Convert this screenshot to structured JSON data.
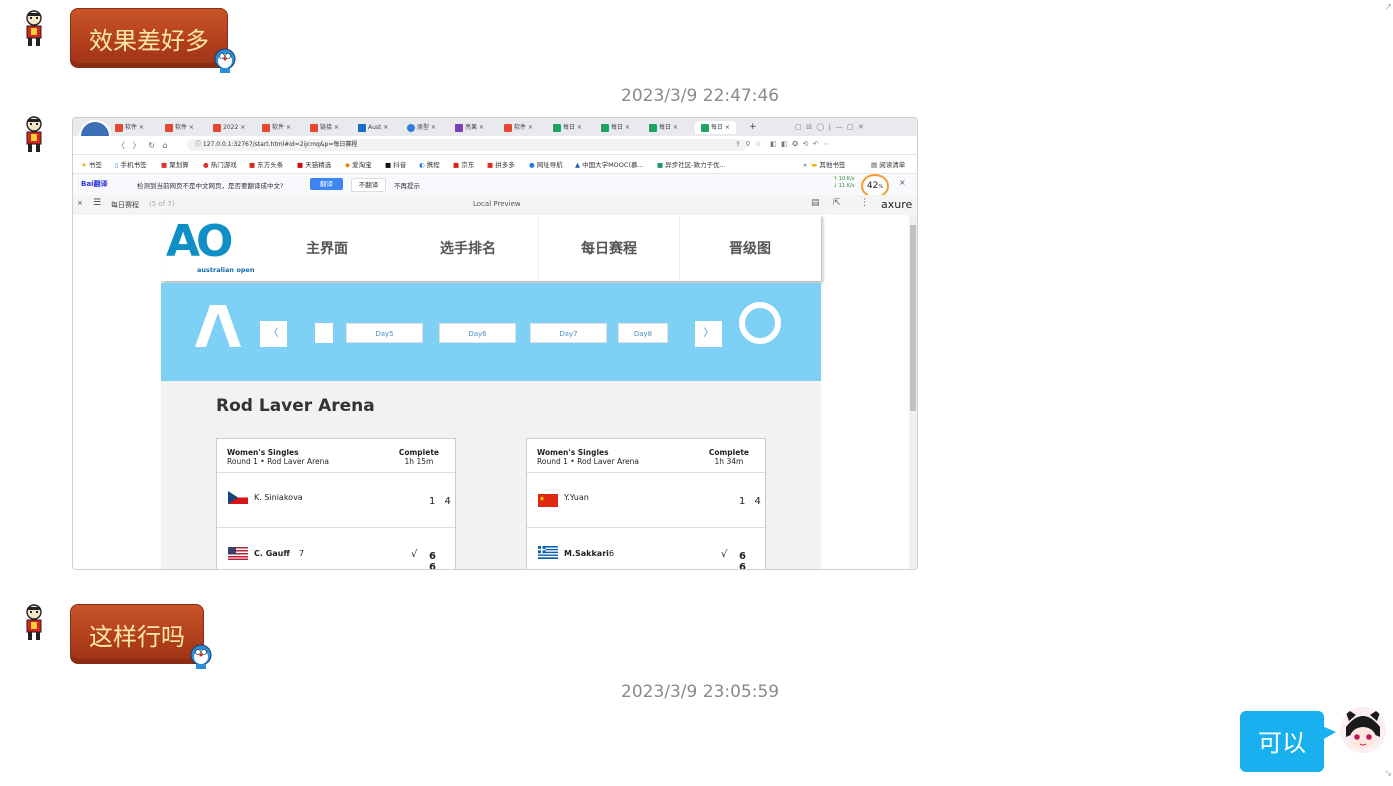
{
  "chat": {
    "msg1": "效果差好多",
    "timestamp1": "2023/3/9 22:47:46",
    "msg2": "这样行吗",
    "timestamp2": "2023/3/9 23:05:59",
    "msg3": "可以"
  },
  "screenshot": {
    "tabs": [
      "软件",
      "软件",
      "2022",
      "软件",
      "链接",
      "Aust",
      "原型",
      "亮果",
      "软件",
      "每日",
      "每日",
      "每日",
      "每日"
    ],
    "address": "127.0.0.1:32767/start.html#id=2ijcmq&p=每日赛程",
    "bookmarks": [
      "书签",
      "手机书签",
      "聚划算",
      "热门游戏",
      "东方头条",
      "天猫精选",
      "爱淘宝",
      "抖音",
      "携程",
      "京东",
      "拼多多",
      "网址导航",
      "中国大学MOOC(慕...",
      "异步社区-致力于优...",
      "其他书签",
      "阅读清单"
    ],
    "translate": {
      "logo": "Bai翻译",
      "message": "检测到当前网页不是中文网页，是否要翻译成中文?",
      "translate_btn": "翻译",
      "no_translate_btn": "不翻译",
      "never_btn": "不再提示",
      "net_up": "10 K/s",
      "net_down": "11 K/s",
      "percent": "42",
      "percent_unit": "%"
    },
    "axure": {
      "page_name": "每日赛程",
      "page_count": "(5 of 7)",
      "preview_label": "Local Preview",
      "brand": "axure"
    },
    "site": {
      "logo_text": "AO",
      "logo_sub": "australian open",
      "nav": [
        "主界面",
        "选手排名",
        "每日赛程",
        "晋级图"
      ],
      "prev": "〈",
      "next": "〉",
      "days": [
        "Day5",
        "Day6",
        "Day7",
        "Day8"
      ],
      "arena": "Rod Laver Arena",
      "matches": [
        {
          "event": "Women's Singles",
          "round": "Round 1 • Rod Laver Arena",
          "status": "Complete",
          "duration": "1h 15m",
          "p1_name": "K. Siniakova",
          "p1_seed": "",
          "p1_score": "1 4",
          "p1_check": "",
          "p2_name": "C. Gauff",
          "p2_seed": "7",
          "p2_check": "√",
          "p2_score": "6 6"
        },
        {
          "event": "Women's Singles",
          "round": "Round 1 • Rod Laver Arena",
          "status": "Complete",
          "duration": "1h 34m",
          "p1_name": "Y.Yuan",
          "p1_seed": "",
          "p1_score": "1 4",
          "p1_check": "",
          "p2_name": "M.Sakkari",
          "p2_seed": "6",
          "p2_check": "√",
          "p2_score": "6 6"
        }
      ]
    }
  },
  "colors": {
    "bubble_left": "#b5421e",
    "bubble_left_text": "#ffe9a6",
    "bubble_right": "#18b0ee",
    "ao_blue": "#0f8fc6",
    "banner": "#7fd0f5"
  }
}
